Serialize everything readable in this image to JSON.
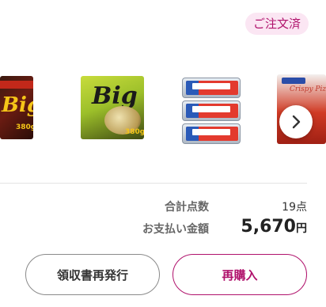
{
  "order_status": {
    "badge": "ご注文済"
  },
  "products": [
    {
      "name": "Big spaghetti (red box)",
      "big_text": "Big",
      "price_text": "380g"
    },
    {
      "name": "Big spaghetti (green box)",
      "big_text": "Big",
      "price_text": "380g"
    },
    {
      "name": "canned tuna 3-pack"
    },
    {
      "name": "Crispy Pizza",
      "brand_text": "Crispy Pizza"
    }
  ],
  "carousel": {
    "next_icon": "chevron-right-icon"
  },
  "summary": {
    "count_label": "合計点数",
    "count_value": "19点",
    "amount_label": "お支払い金額",
    "amount_value": "5,670",
    "amount_unit": "円"
  },
  "actions": {
    "receipt_label": "領収書再発行",
    "rebuy_label": "再購入"
  },
  "colors": {
    "accent": "#b0126c",
    "badge_bg": "#fbe6f3"
  }
}
